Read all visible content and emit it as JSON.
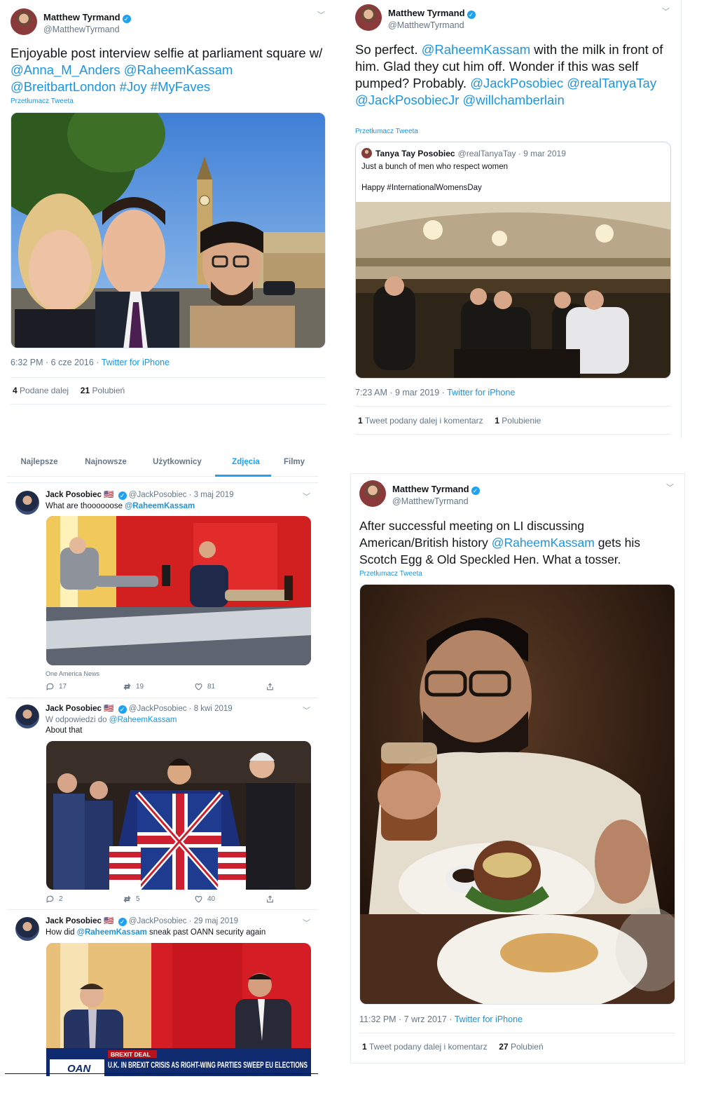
{
  "tweet1": {
    "display_name": "Matthew Tyrmand",
    "handle": "@MatthewTyrmand",
    "text_parts": {
      "p1": "Enjoyable post interview selfie at parliament square w/",
      "m1": "@Anna_M_Anders",
      "m2": "@RaheemKassam",
      "m3": "@BreitbartLondon",
      "h1": "#Joy",
      "h2": "#MyFaves"
    },
    "translate": "Przetłumacz Tweeta",
    "time": "6:32 PM · 6 cze 2016 · ",
    "source": "Twitter for iPhone",
    "retweets_count": "4",
    "retweets_label": "Podane dalej",
    "likes_count": "21",
    "likes_label": "Polubień"
  },
  "tweet2": {
    "display_name": "Matthew Tyrmand",
    "handle": "@MatthewTyrmand",
    "text_parts": {
      "p1": "So perfect.",
      "m1": "@RaheemKassam",
      "p2": "with the milk in front of him. Glad they cut him off. Wonder if this was self pumped? Probably.",
      "m2": "@JackPosobiec",
      "m3": "@realTanyaTay",
      "m4": "@JackPosobiecJr",
      "m5": "@willchamberlain"
    },
    "translate": "Przetłumacz Tweeta",
    "quote": {
      "display_name": "Tanya Tay Posobiec",
      "handle_date": "@realTanyaTay · 9 mar 2019",
      "line1": "Just a bunch of men who respect women",
      "line2": "Happy #InternationalWomensDay"
    },
    "time": "7:23 AM · 9 mar 2019 · ",
    "source": "Twitter for iPhone",
    "retweets_count": "1",
    "retweets_label": "Tweet podany dalej i komentarz",
    "likes_count": "1",
    "likes_label": "Polubienie"
  },
  "search_tabs": [
    "Najlepsze",
    "Najnowsze",
    "Użytkownicy",
    "Zdjęcia",
    "Filmy"
  ],
  "active_tab": "Zdjęcia",
  "feed": [
    {
      "display_name": "Jack Posobiec",
      "flag": "🇺🇸",
      "handle_date": "@JackPosobiec · 3 maj 2019",
      "text_plain": "What are thoooooose",
      "text_mention": "@RaheemKassam",
      "caption": "One America News",
      "replies": "17",
      "retweets": "19",
      "likes": "81"
    },
    {
      "display_name": "Jack Posobiec",
      "flag": "🇺🇸",
      "handle_date": "@JackPosobiec · 8 kwi 2019",
      "reply_prefix": "W odpowiedzi do",
      "reply_to": "@RaheemKassam",
      "text_plain": "About that",
      "replies": "2",
      "retweets": "5",
      "likes": "40"
    },
    {
      "display_name": "Jack Posobiec",
      "flag": "🇺🇸",
      "handle_date": "@JackPosobiec · 29 maj 2019",
      "text_plain1": "How did",
      "text_mention": "@RaheemKassam",
      "text_plain2": "sneak past OANN security again",
      "chyron_top": "BREXIT DEAL",
      "chyron_logo": "OAN",
      "chyron_line": "U.K. IN BREXIT CRISIS AS RIGHT-WING PARTIES SWEEP EU ELECTIONS"
    }
  ],
  "tweet4": {
    "display_name": "Matthew Tyrmand",
    "handle": "@MatthewTyrmand",
    "text_parts": {
      "p1": "After successful meeting on LI discussing American/British history",
      "m1": "@RaheemKassam",
      "p2": "gets his Scotch Egg & Old Speckled Hen. What a tosser."
    },
    "translate": "Przetłumacz Tweeta",
    "time": "11:32 PM · 7 wrz 2017 · ",
    "source": "Twitter for iPhone",
    "retweets_count": "1",
    "retweets_label": "Tweet podany dalej i komentarz",
    "likes_count": "27",
    "likes_label": "Polubień"
  },
  "colors": {
    "link": "#1b95e0",
    "verified": "#1da1f2",
    "muted": "#657786"
  }
}
